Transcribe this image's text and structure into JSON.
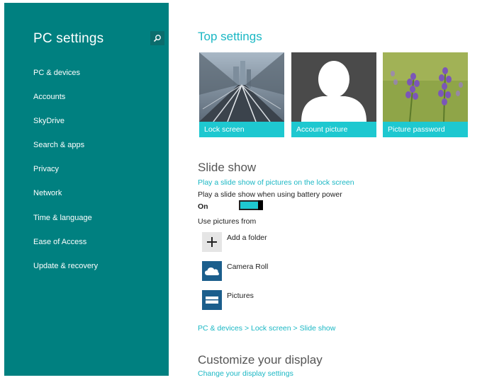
{
  "sidebar": {
    "title": "PC settings",
    "search_icon": "search-icon",
    "items": [
      {
        "label": "PC & devices"
      },
      {
        "label": "Accounts"
      },
      {
        "label": "SkyDrive"
      },
      {
        "label": "Search & apps"
      },
      {
        "label": "Privacy"
      },
      {
        "label": "Network"
      },
      {
        "label": "Time & language"
      },
      {
        "label": "Ease of Access"
      },
      {
        "label": "Update & recovery"
      }
    ]
  },
  "main": {
    "top_settings_title": "Top settings",
    "tiles": [
      {
        "label": "Lock screen"
      },
      {
        "label": "Account picture"
      },
      {
        "label": "Picture password"
      }
    ],
    "slideshow": {
      "title": "Slide show",
      "play_link": "Play a slide show of pictures on the lock screen",
      "battery_label": "Play a slide show when using battery power",
      "toggle_state": "On",
      "use_pictures_label": "Use pictures from",
      "sources": [
        {
          "label": "Add a folder",
          "icon": "plus-icon"
        },
        {
          "label": "Camera Roll",
          "icon": "skydrive-cloud-icon"
        },
        {
          "label": "Pictures",
          "icon": "pictures-library-icon"
        }
      ]
    },
    "breadcrumb": "PC & devices > Lock screen > Slide show",
    "customize": {
      "title": "Customize your display",
      "link": "Change your display settings"
    }
  },
  "colors": {
    "sidebar_bg": "#008080",
    "accent": "#1ec8d0",
    "link": "#1ab7c4",
    "tile_dark_bg": "#4a4a4a",
    "library_blue": "#1b5e8c"
  }
}
